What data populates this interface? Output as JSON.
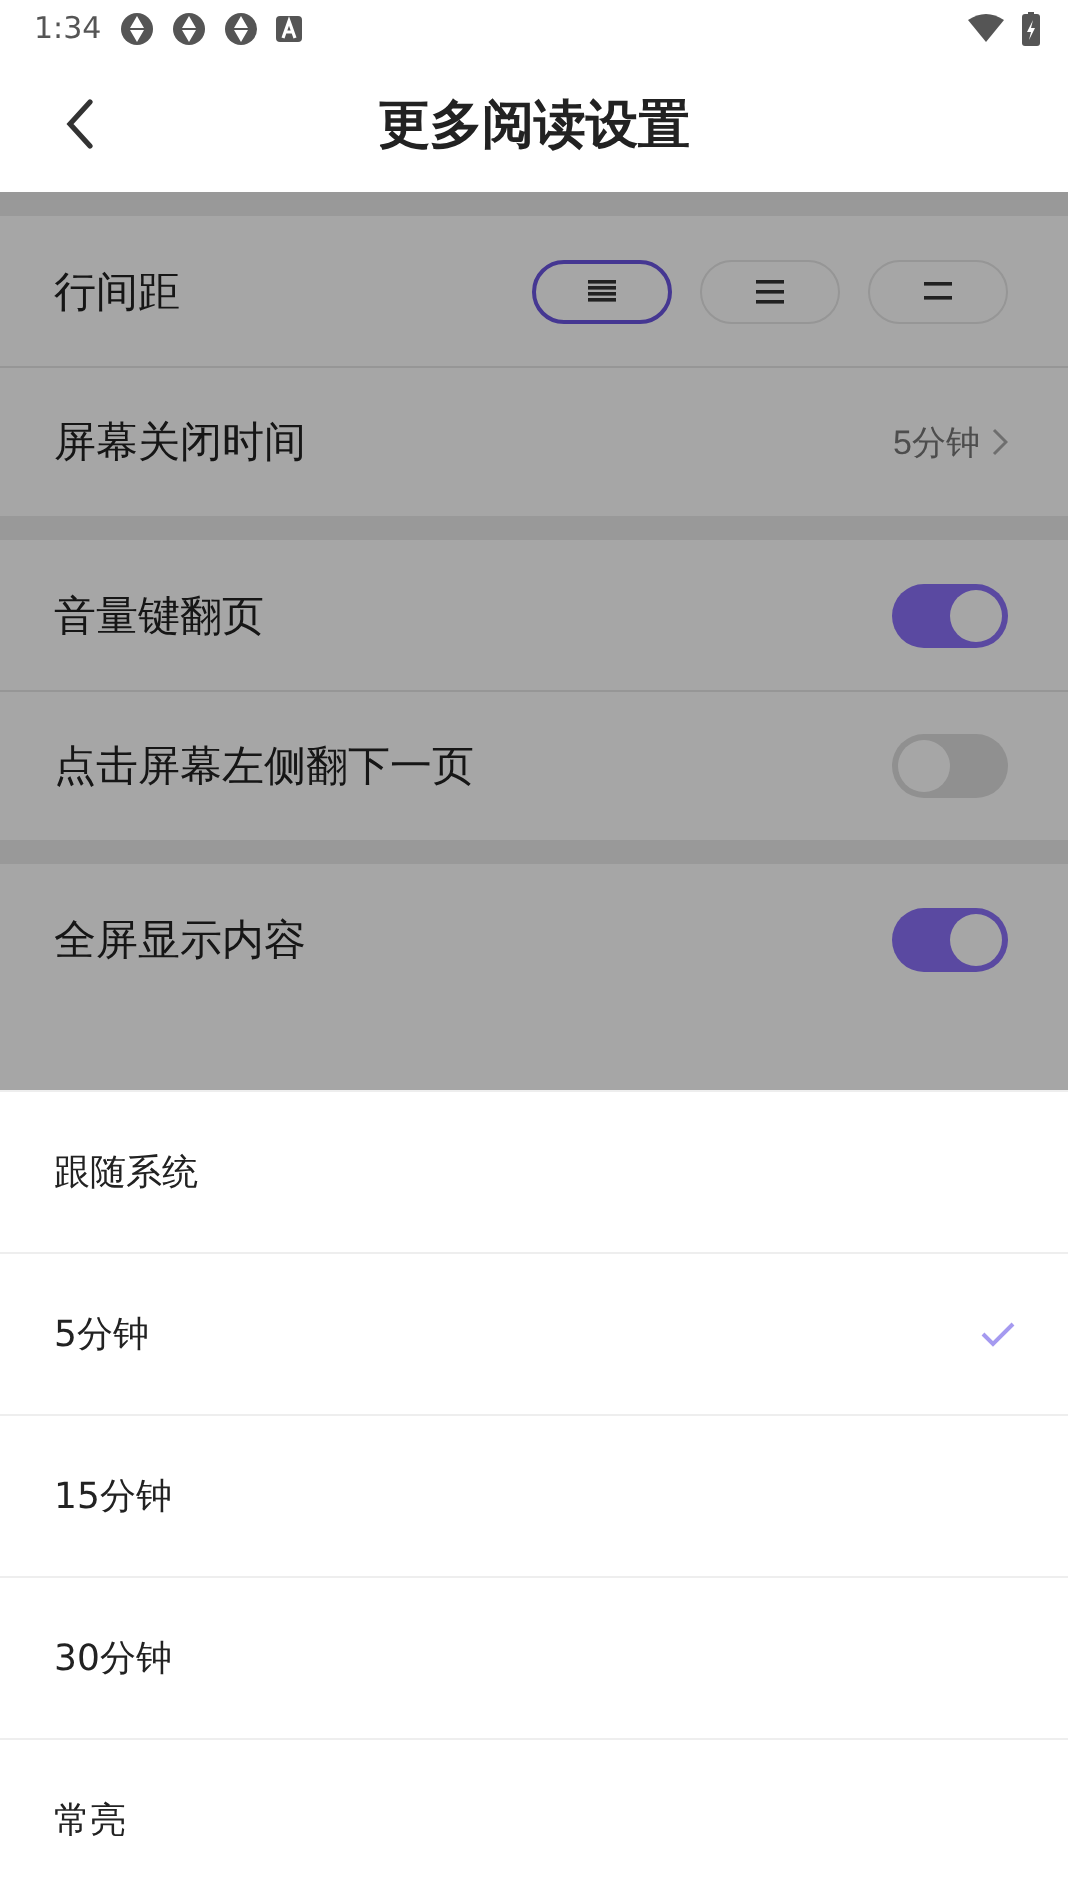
{
  "status_bar": {
    "time": "1:34"
  },
  "header": {
    "title": "更多阅读设置"
  },
  "sections": [
    {
      "rows": [
        {
          "kind": "spacing",
          "label": "行间距",
          "options": [
            {
              "kind": "tight",
              "selected": true
            },
            {
              "kind": "medium",
              "selected": false
            },
            {
              "kind": "loose",
              "selected": false
            }
          ]
        },
        {
          "kind": "value",
          "label": "屏幕关闭时间",
          "value": "5分钟"
        }
      ]
    },
    {
      "rows": [
        {
          "kind": "toggle",
          "label": "音量键翻页",
          "on": true
        },
        {
          "kind": "toggle",
          "label": "点击屏幕左侧翻下一页",
          "on": false
        }
      ]
    },
    {
      "rows": [
        {
          "kind": "toggle",
          "label": "全屏显示内容",
          "on": true
        }
      ]
    }
  ],
  "sheet": {
    "options": [
      {
        "label": "跟随系统",
        "selected": false
      },
      {
        "label": "5分钟",
        "selected": true
      },
      {
        "label": "15分钟",
        "selected": false
      },
      {
        "label": "30分钟",
        "selected": false
      },
      {
        "label": "常亮",
        "selected": false
      }
    ]
  }
}
